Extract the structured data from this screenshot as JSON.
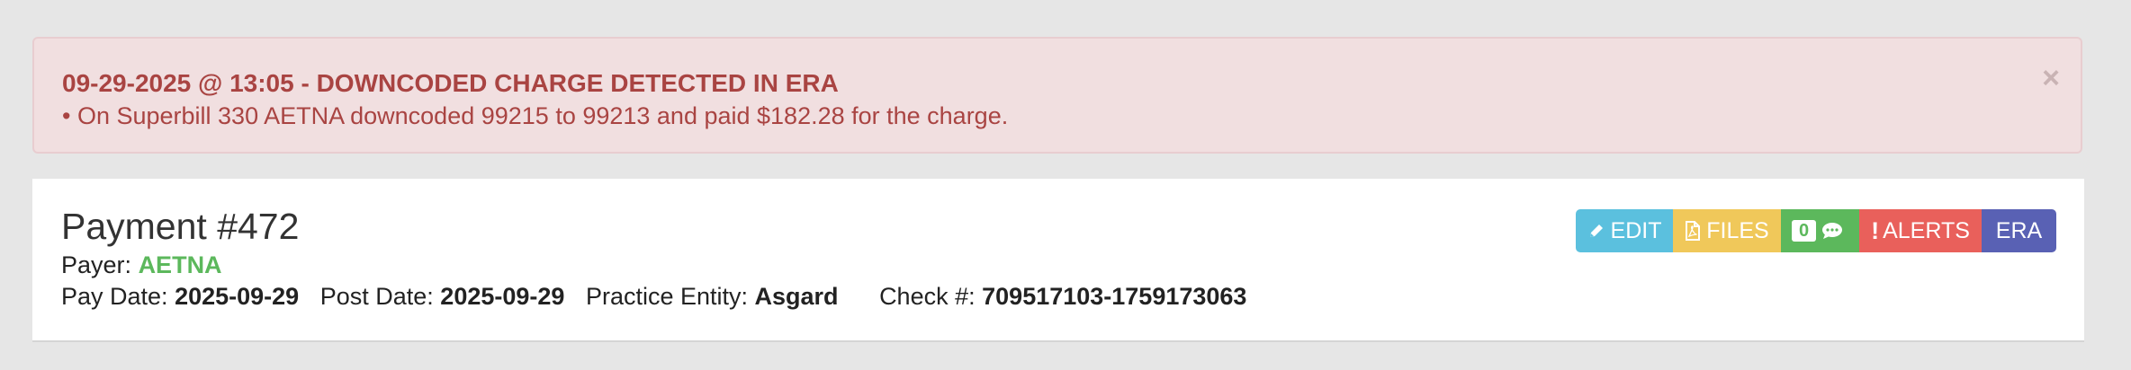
{
  "alert": {
    "title": "09-29-2025 @ 13:05 - DOWNCODED CHARGE DETECTED IN ERA",
    "message": "• On Superbill 330 AETNA downcoded 99215 to 99213 and paid $182.28 for the charge.",
    "close_symbol": "×"
  },
  "payment": {
    "title": "Payment #472",
    "payer_label": "Payer:",
    "payer_name": "AETNA",
    "pay_date_label": "Pay Date:",
    "pay_date": "2025-09-29",
    "post_date_label": "Post Date:",
    "post_date": "2025-09-29",
    "practice_entity_label": "Practice Entity:",
    "practice_entity": "Asgard",
    "check_label": "Check #:",
    "check_number": "709517103-1759173063"
  },
  "toolbar": {
    "edit_label": "EDIT",
    "files_label": "FILES",
    "notes_count": "0",
    "alerts_exclamation": "!",
    "alerts_label": "ALERTS",
    "era_label": "ERA",
    "icons": {
      "edit": "pencil-icon",
      "files": "pdf-file-icon",
      "notes": "comment-icon"
    }
  },
  "colors": {
    "alert_background": "#f1dfe0",
    "alert_text": "#a94442",
    "payer_green": "#5cb85c",
    "edit_button": "#5bc0de",
    "files_button": "#f0c85a",
    "notes_button": "#5cb85c",
    "alerts_button": "#e9605b",
    "era_button": "#5961b4"
  }
}
